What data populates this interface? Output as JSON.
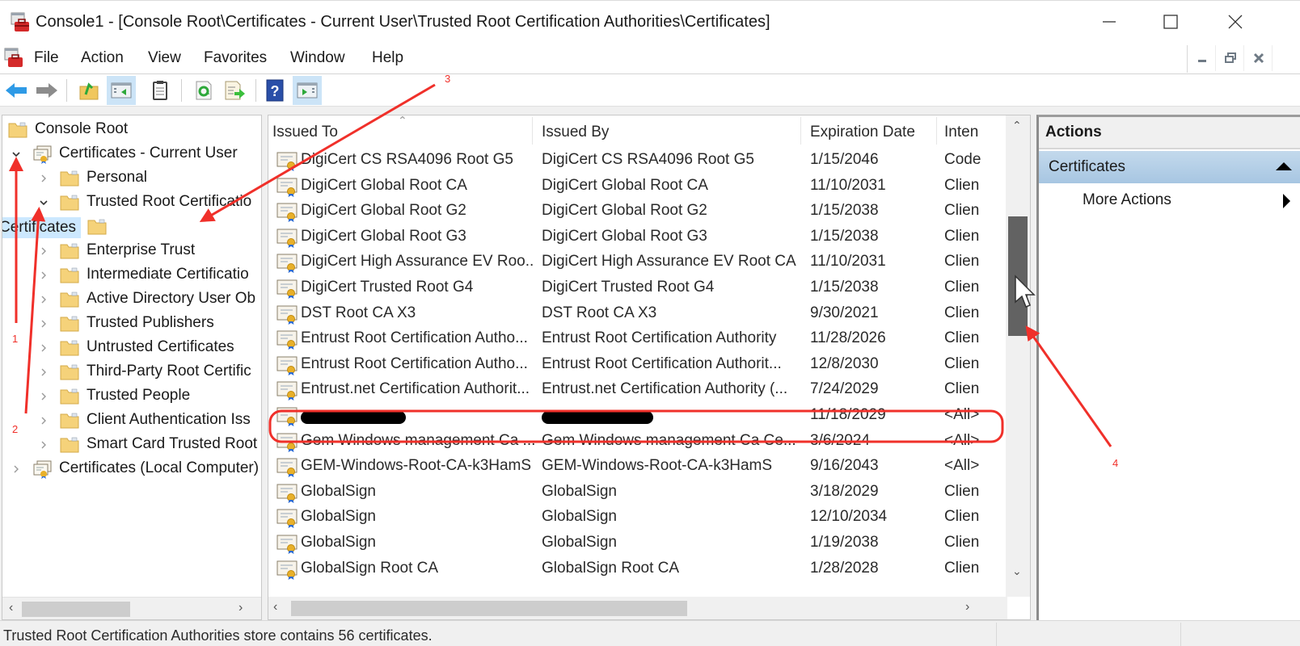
{
  "window": {
    "title": "Console1 - [Console Root\\Certificates - Current User\\Trusted Root Certification Authorities\\Certificates]",
    "controls": [
      "minimize",
      "maximize",
      "close"
    ]
  },
  "menu": {
    "items": [
      "File",
      "Action",
      "View",
      "Favorites",
      "Window",
      "Help"
    ],
    "mdi_controls": [
      "minimize",
      "restore",
      "close"
    ]
  },
  "toolbar": {
    "buttons": [
      {
        "name": "back",
        "icon": "back-arrow-icon"
      },
      {
        "name": "forward",
        "icon": "forward-arrow-icon"
      },
      {
        "name": "up-one-level",
        "icon": "up-folder-icon"
      },
      {
        "name": "show-hide-console-tree",
        "icon": "console-tree-icon",
        "active": true
      },
      {
        "name": "export-list",
        "icon": "clipboard-icon"
      },
      {
        "name": "refresh",
        "icon": "refresh-icon"
      },
      {
        "name": "export",
        "icon": "export-icon"
      },
      {
        "name": "help",
        "icon": "help-icon"
      },
      {
        "name": "show-hide-action-pane",
        "icon": "action-pane-icon",
        "active": true
      }
    ]
  },
  "tree": {
    "nodes": [
      {
        "label": "Console Root",
        "level": 0,
        "expander": "none",
        "icon": "folder"
      },
      {
        "label": "Certificates - Current User",
        "level": 1,
        "expander": "expanded",
        "icon": "certificate-store"
      },
      {
        "label": "Personal",
        "level": 2,
        "expander": "collapsed",
        "icon": "folder"
      },
      {
        "label": "Trusted Root Certificatio",
        "level": 2,
        "expander": "expanded",
        "icon": "folder"
      },
      {
        "label": "Certificates",
        "level": 3,
        "expander": "none",
        "icon": "folder",
        "selected": true
      },
      {
        "label": "Enterprise Trust",
        "level": 2,
        "expander": "collapsed",
        "icon": "folder"
      },
      {
        "label": "Intermediate Certificatio",
        "level": 2,
        "expander": "collapsed",
        "icon": "folder"
      },
      {
        "label": "Active Directory User Ob",
        "level": 2,
        "expander": "collapsed",
        "icon": "folder"
      },
      {
        "label": "Trusted Publishers",
        "level": 2,
        "expander": "collapsed",
        "icon": "folder"
      },
      {
        "label": "Untrusted Certificates",
        "level": 2,
        "expander": "collapsed",
        "icon": "folder"
      },
      {
        "label": "Third-Party Root Certific",
        "level": 2,
        "expander": "collapsed",
        "icon": "folder"
      },
      {
        "label": "Trusted People",
        "level": 2,
        "expander": "collapsed",
        "icon": "folder"
      },
      {
        "label": "Client Authentication Iss",
        "level": 2,
        "expander": "collapsed",
        "icon": "folder"
      },
      {
        "label": "Smart Card Trusted Root",
        "level": 2,
        "expander": "collapsed",
        "icon": "folder"
      },
      {
        "label": "Certificates (Local Computer)",
        "level": 1,
        "expander": "collapsed",
        "icon": "certificate-store"
      }
    ]
  },
  "list": {
    "columns": [
      "Issued To",
      "Issued By",
      "Expiration Date",
      "Inten"
    ],
    "rows": [
      {
        "issued_to": "DigiCert CS RSA4096 Root G5",
        "issued_by": "DigiCert CS RSA4096 Root G5",
        "expiration": "1/15/2046",
        "intended": "Code"
      },
      {
        "issued_to": "DigiCert Global Root CA",
        "issued_by": "DigiCert Global Root CA",
        "expiration": "11/10/2031",
        "intended": "Clien"
      },
      {
        "issued_to": "DigiCert Global Root G2",
        "issued_by": "DigiCert Global Root G2",
        "expiration": "1/15/2038",
        "intended": "Clien"
      },
      {
        "issued_to": "DigiCert Global Root G3",
        "issued_by": "DigiCert Global Root G3",
        "expiration": "1/15/2038",
        "intended": "Clien"
      },
      {
        "issued_to": "DigiCert High Assurance EV Roo...",
        "issued_by": "DigiCert High Assurance EV Root CA",
        "expiration": "11/10/2031",
        "intended": "Clien"
      },
      {
        "issued_to": "DigiCert Trusted Root G4",
        "issued_by": "DigiCert Trusted Root G4",
        "expiration": "1/15/2038",
        "intended": "Clien"
      },
      {
        "issued_to": "DST Root CA X3",
        "issued_by": "DST Root CA X3",
        "expiration": "9/30/2021",
        "intended": "Clien"
      },
      {
        "issued_to": "Entrust Root Certification Autho...",
        "issued_by": "Entrust Root Certification Authority",
        "expiration": "11/28/2026",
        "intended": "Clien"
      },
      {
        "issued_to": "Entrust Root Certification Autho...",
        "issued_by": "Entrust Root Certification Authorit...",
        "expiration": "12/8/2030",
        "intended": "Clien"
      },
      {
        "issued_to": "Entrust.net Certification Authorit...",
        "issued_by": "Entrust.net Certification Authority (...",
        "expiration": "7/24/2029",
        "intended": "Clien"
      },
      {
        "issued_to": "",
        "issued_by": "",
        "expiration": "11/18/2029",
        "intended": "<All>",
        "redacted": true,
        "highlighted": true
      },
      {
        "issued_to": "Gem Windows management Ca ...",
        "issued_by": "Gem Windows management Ca Ce...",
        "expiration": "3/6/2024",
        "intended": "<All>"
      },
      {
        "issued_to": "GEM-Windows-Root-CA-k3HamS",
        "issued_by": "GEM-Windows-Root-CA-k3HamS",
        "expiration": "9/16/2043",
        "intended": "<All>"
      },
      {
        "issued_to": "GlobalSign",
        "issued_by": "GlobalSign",
        "expiration": "3/18/2029",
        "intended": "Clien"
      },
      {
        "issued_to": "GlobalSign",
        "issued_by": "GlobalSign",
        "expiration": "12/10/2034",
        "intended": "Clien"
      },
      {
        "issued_to": "GlobalSign",
        "issued_by": "GlobalSign",
        "expiration": "1/19/2038",
        "intended": "Clien"
      },
      {
        "issued_to": "GlobalSign Root CA",
        "issued_by": "GlobalSign Root CA",
        "expiration": "1/28/2028",
        "intended": "Clien"
      }
    ]
  },
  "actions": {
    "title": "Actions",
    "section": "Certificates",
    "items": [
      "More Actions"
    ]
  },
  "status": {
    "text": "Trusted Root Certification Authorities store contains 56 certificates."
  },
  "annotations": {
    "labels": [
      "1",
      "2",
      "3",
      "4"
    ],
    "color": "#f0302a"
  }
}
